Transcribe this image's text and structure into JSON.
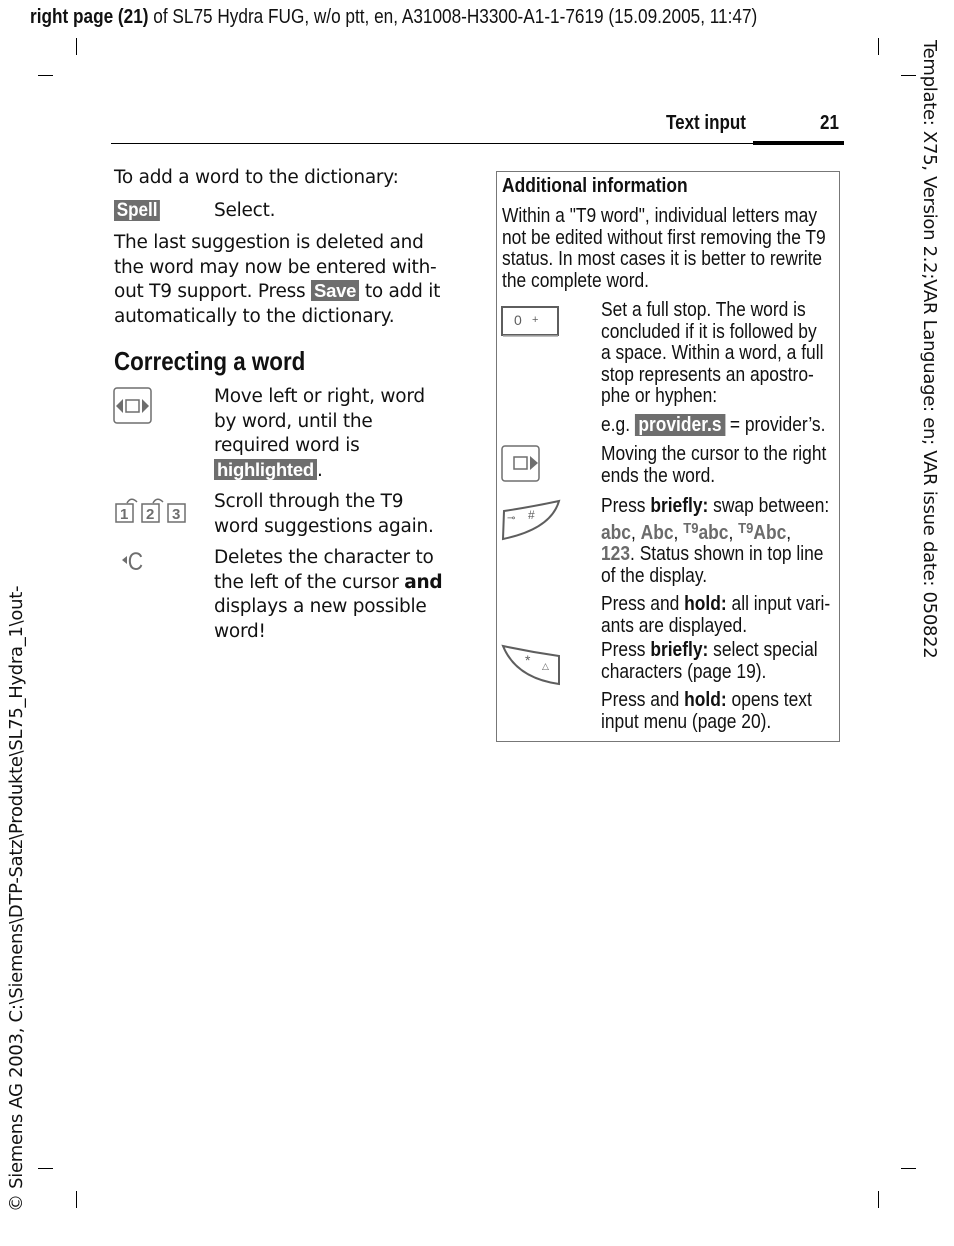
{
  "print_header": {
    "bold_part": "right page (21)",
    "rest": " of SL75 Hydra FUG, w/o ptt, en, A31008-H3300-A1-1-7619 (15.09.2005, 11:47)"
  },
  "side_right_text": "Template: X75, Version 2.2;VAR Language: en; VAR issue date: 050822",
  "side_left_text": "© Siemens AG 2003, C:\\Siemens\\DTP-Satz\\Produkte\\SL75_Hydra_1\\out-",
  "running_header": {
    "title": "Text input",
    "page_number": "21"
  },
  "left_column": {
    "intro": "To add a word to the dictionary:",
    "spell_row": {
      "softkey": "Spell",
      "text": "Select."
    },
    "para": {
      "line1": "The last suggestion is deleted and",
      "line2": "the word may now be entered with-",
      "line3a": "out T9 support. Press ",
      "softkey": "Save",
      "line3b": " to add it",
      "line4": "automatically to the dictionary."
    },
    "heading": "Correcting a word",
    "rows": [
      {
        "icon": "nav-left-right-icon",
        "lines": [
          "Move left or right, word",
          "by word, until the",
          "required word is"
        ],
        "highlight": "highlighted",
        "suffix": "."
      },
      {
        "icon": "keys-1-2-3-icon",
        "lines": [
          "Scroll through the T9",
          "word suggestions again."
        ]
      },
      {
        "icon": "clear-key-icon",
        "line1": "Deletes the character to",
        "line2a": "the left of the cursor ",
        "line2b": "and",
        "line3": "displays a new possible",
        "line4": "word!"
      }
    ]
  },
  "info_box": {
    "title": "Additional information",
    "intro": [
      "Within a \"T9 word\", individual letters may",
      "not be edited without first removing the T9",
      "status. In most cases it is better to rewrite",
      "the complete word."
    ],
    "items": [
      {
        "icon": "key-0-plus-icon",
        "key_label": "0 +",
        "lines": [
          "Set a full stop. The word is",
          "concluded if it is followed by",
          "a space. Within a word, a full",
          "stop represents an apostro-",
          "phe or hyphen:"
        ],
        "example_prefix": "e.g. ",
        "example_tag": "provider.s",
        "example_suffix": " = provider’s."
      },
      {
        "icon": "nav-right-icon",
        "lines": [
          "Moving the cursor to the right",
          "ends the word."
        ]
      },
      {
        "icon": "hash-key-icon",
        "press": "Press ",
        "briefly": "briefly:",
        "swap": " swap between:",
        "modes": {
          "m1": "abc",
          "m2": "Abc",
          "t9": "T9",
          "m3": "abc",
          "m4": "Abc",
          "m5": "123"
        },
        "status_line": ". Status shown in top line",
        "status_line2": "of the display.",
        "hold_prefix": "Press and ",
        "hold": "hold:",
        "hold_text1": " all input vari-",
        "hold_text2": "ants are displayed."
      },
      {
        "icon": "star-key-icon",
        "press": "Press ",
        "briefly": "briefly:",
        "brief_text1": " select special",
        "brief_text2": "characters (page 19).",
        "hold_prefix": "Press and ",
        "hold": "hold:",
        "hold_text1": " opens text",
        "hold_text2": "input menu (page 20)."
      }
    ]
  }
}
